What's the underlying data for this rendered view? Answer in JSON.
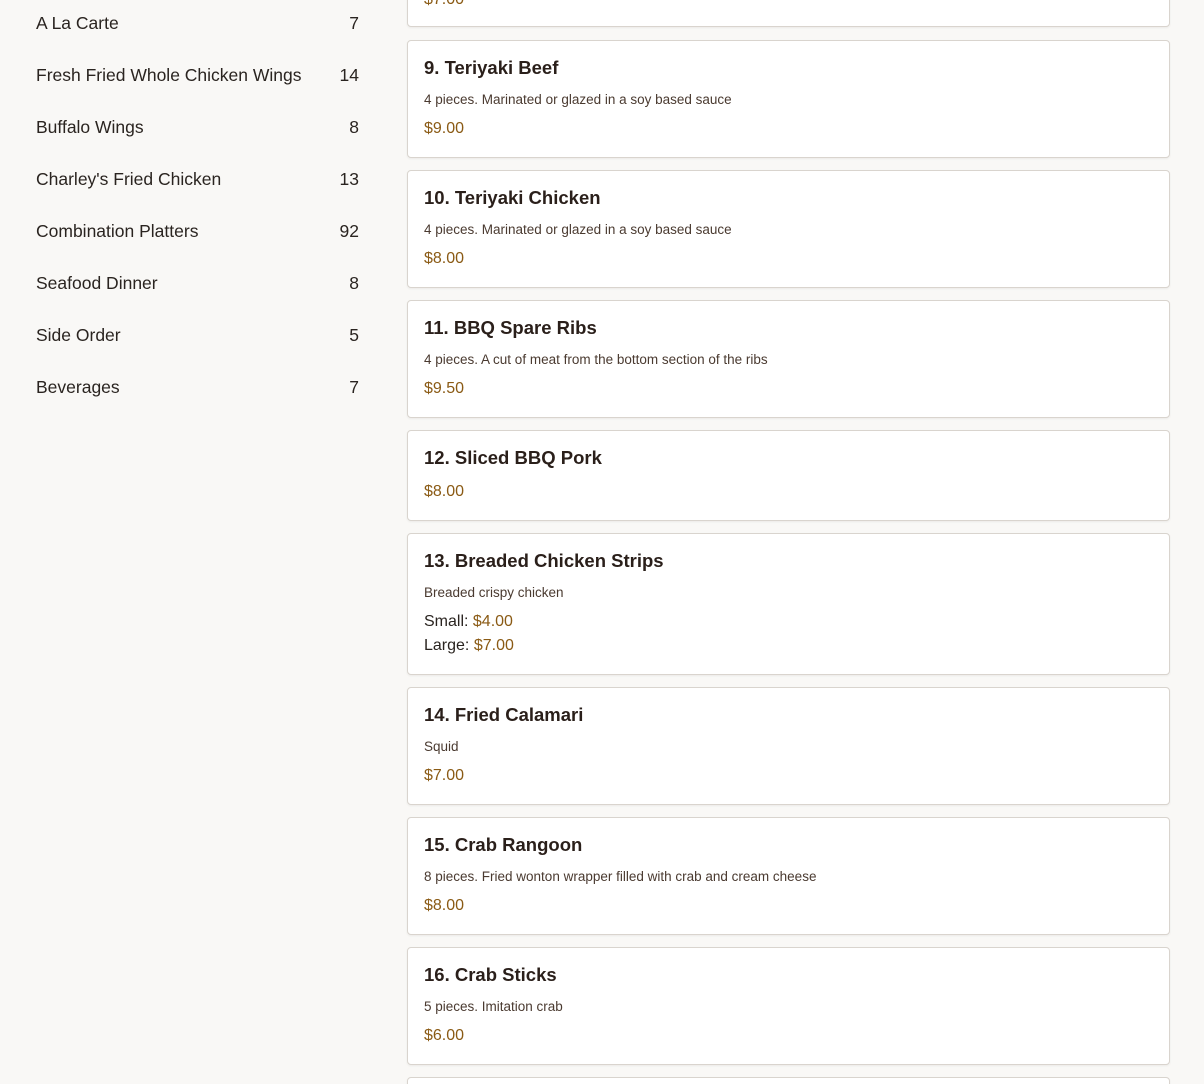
{
  "sidebar": {
    "categories": [
      {
        "label": "A La Carte",
        "count": "7"
      },
      {
        "label": "Fresh Fried Whole Chicken Wings",
        "count": "14"
      },
      {
        "label": "Buffalo Wings",
        "count": "8"
      },
      {
        "label": "Charley's Fried Chicken",
        "count": "13"
      },
      {
        "label": "Combination Platters",
        "count": "92"
      },
      {
        "label": "Seafood Dinner",
        "count": "8"
      },
      {
        "label": "Side Order",
        "count": "5"
      },
      {
        "label": "Beverages",
        "count": "7"
      }
    ]
  },
  "menu": {
    "partial_top_price": "$7.00",
    "items": [
      {
        "title": "9. Teriyaki Beef",
        "desc": "4 pieces. Marinated or glazed in a soy based sauce",
        "price": "$9.00"
      },
      {
        "title": "10. Teriyaki Chicken",
        "desc": "4 pieces. Marinated or glazed in a soy based sauce",
        "price": "$8.00"
      },
      {
        "title": "11. BBQ Spare Ribs",
        "desc": "4 pieces. A cut of meat from the bottom section of the ribs",
        "price": "$9.50"
      },
      {
        "title": "12. Sliced BBQ Pork",
        "price": "$8.00"
      },
      {
        "title": "13. Breaded Chicken Strips",
        "desc": "Breaded crispy chicken",
        "options": [
          {
            "label": "Small:",
            "price": "$4.00"
          },
          {
            "label": "Large:",
            "price": "$7.00"
          }
        ]
      },
      {
        "title": "14. Fried Calamari",
        "desc": "Squid",
        "price": "$7.00"
      },
      {
        "title": "15. Crab Rangoon",
        "desc": "8 pieces. Fried wonton wrapper filled with crab and cream cheese",
        "price": "$8.00"
      },
      {
        "title": "16. Crab Sticks",
        "desc": "5 pieces. Imitation crab",
        "price": "$6.00"
      }
    ]
  },
  "colors": {
    "price": "#8a5a14",
    "background": "#f9f8f6",
    "card_border": "#d9d4ce"
  }
}
